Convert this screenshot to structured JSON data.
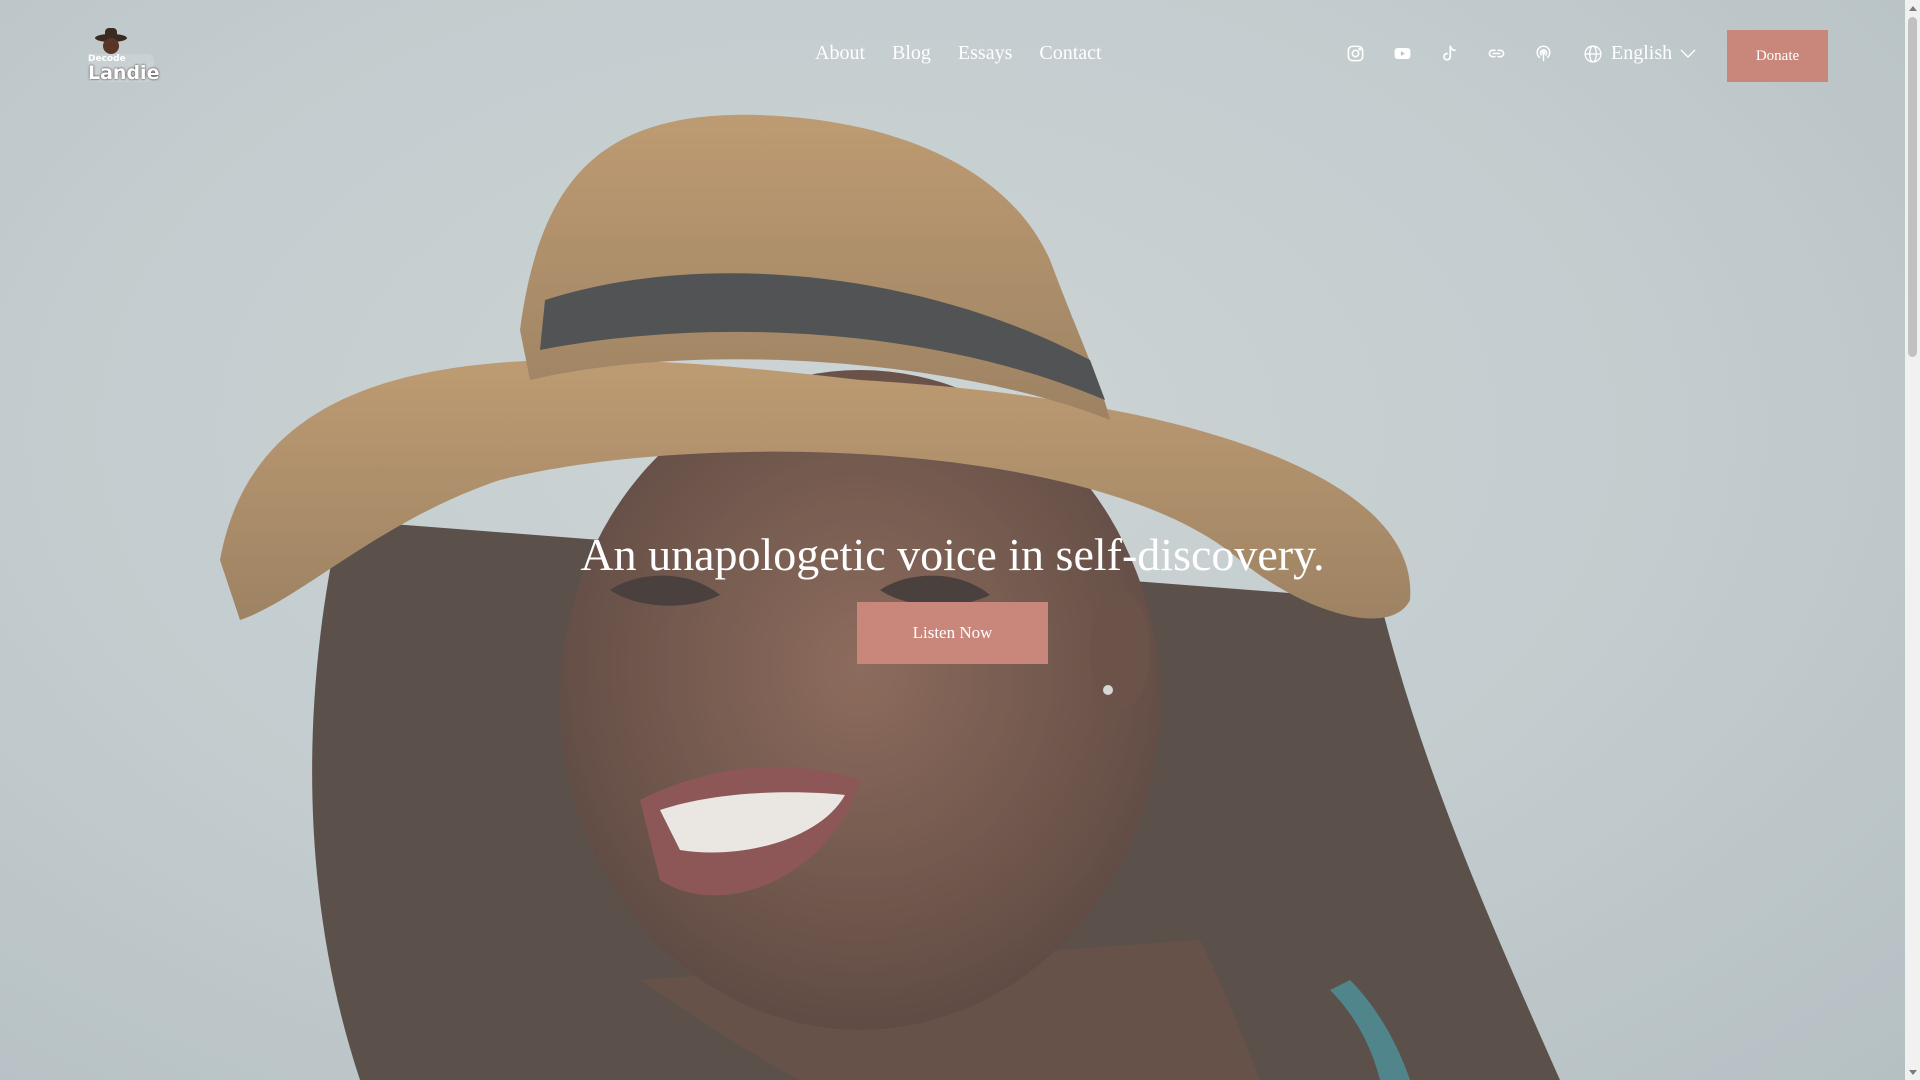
{
  "header": {
    "logo_text_top": "Decode",
    "logo_text_main": "Landie",
    "nav": [
      {
        "label": "About"
      },
      {
        "label": "Blog"
      },
      {
        "label": "Essays"
      },
      {
        "label": "Contact"
      }
    ],
    "socials": [
      {
        "icon": "instagram-icon"
      },
      {
        "icon": "youtube-icon"
      },
      {
        "icon": "tiktok-icon"
      },
      {
        "icon": "link-icon"
      },
      {
        "icon": "podcast-icon"
      }
    ],
    "language": {
      "label": "English",
      "icon": "globe-icon"
    },
    "donate_label": "Donate"
  },
  "hero": {
    "headline": "An unapologetic voice in self-discovery.",
    "cta_label": "Listen Now"
  },
  "colors": {
    "accent": "#c9867a",
    "text": "#ffffff",
    "sky": "#c9d1d3"
  }
}
